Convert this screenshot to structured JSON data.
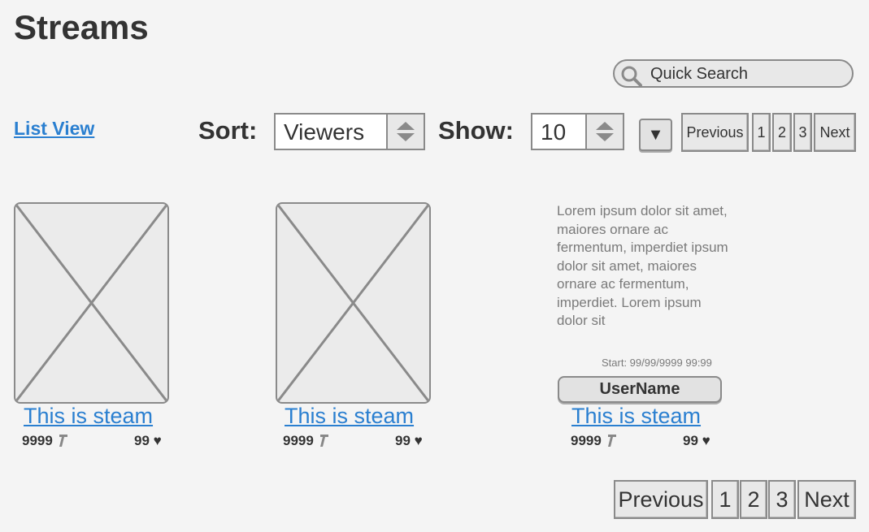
{
  "page": {
    "title": "Streams"
  },
  "search": {
    "label": "Quick Search"
  },
  "view": {
    "list_view_label": "List View"
  },
  "controls": {
    "sort_label": "Sort:",
    "sort_value": "Viewers",
    "show_label": "Show:",
    "show_value": "10",
    "dropdown_glyph": "▼"
  },
  "pagination_top": {
    "previous": "Previous",
    "pages": [
      "1",
      "2",
      "3"
    ],
    "next": "Next"
  },
  "pagination_bottom": {
    "previous": "Previous",
    "pages": [
      "1",
      "2",
      "3"
    ],
    "next": "Next"
  },
  "streams": [
    {
      "title": "This is steam",
      "viewers": "9999",
      "likes": "99 ♥"
    },
    {
      "title": "This is steam",
      "viewers": "9999",
      "likes": "99 ♥"
    },
    {
      "title": "This is steam",
      "viewers": "9999",
      "likes": "99 ♥",
      "description": "Lorem ipsum dolor sit amet, maiores ornare ac fermentum, imperdiet ipsum dolor sit amet, maiores ornare ac fermentum, imperdiet. Lorem ipsum dolor sit",
      "start": "Start: 99/99/9999 99:99",
      "username": "UserName"
    }
  ],
  "icons": {
    "search": "search-icon",
    "viewers": "viewers-icon",
    "sort_spinner": "spinner-arrows-icon"
  },
  "colors": {
    "link": "#2a7fd0",
    "background": "#f4f4f4",
    "border": "#8a8a8a",
    "placeholder_fill": "#ebebeb"
  }
}
